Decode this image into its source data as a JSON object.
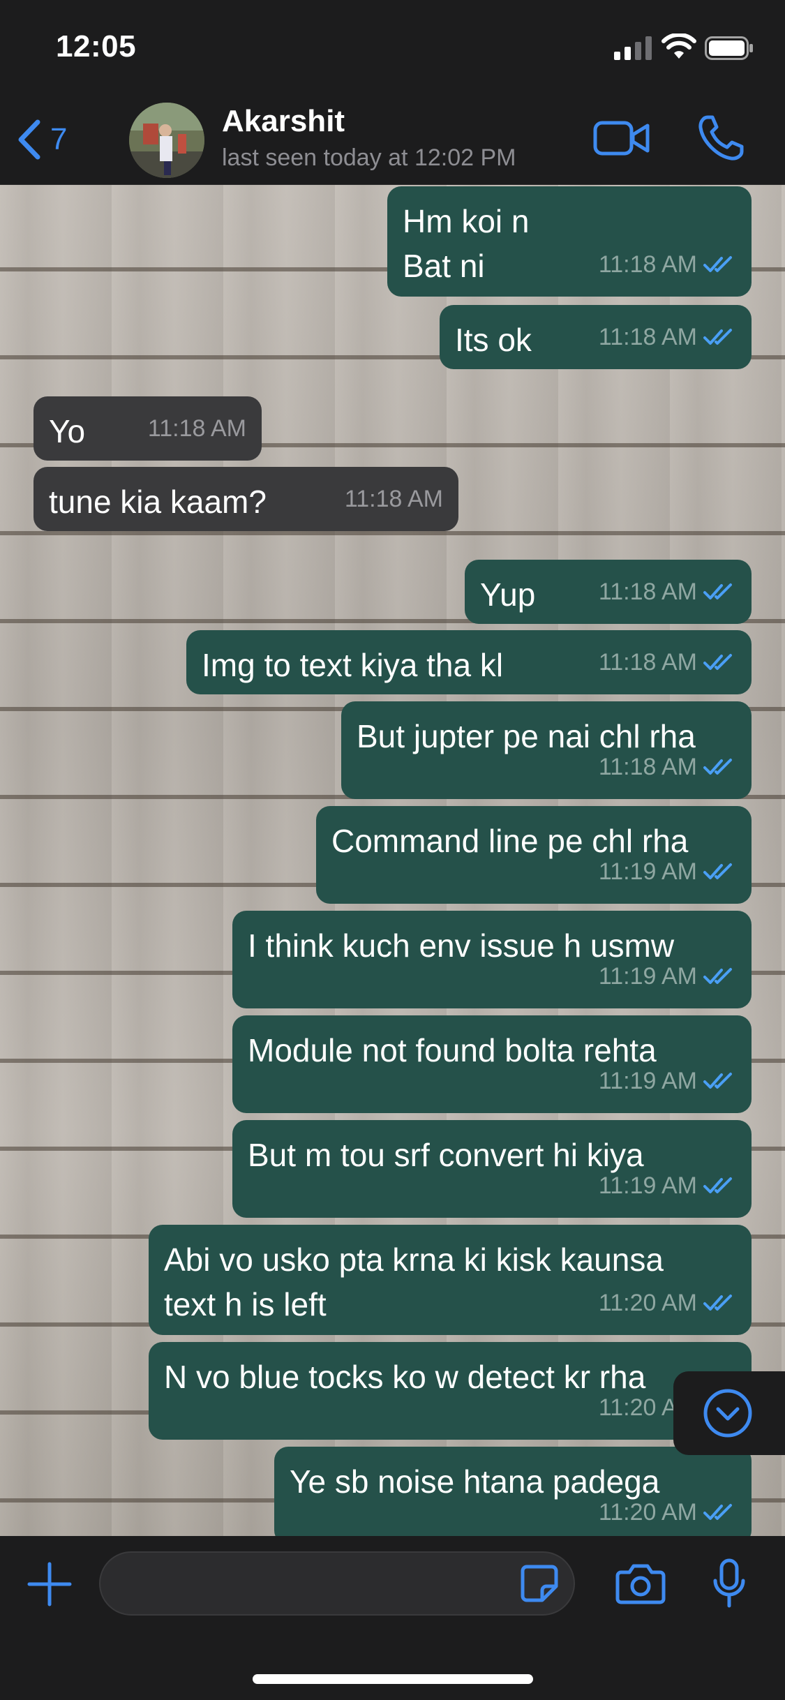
{
  "status_bar": {
    "time": "12:05"
  },
  "header": {
    "back_count": "7",
    "contact_name": "Akarshit",
    "contact_status": "last seen today at 12:02 PM"
  },
  "messages": [
    {
      "text": "Hm koi n\nBat ni",
      "time": "11:18 AM",
      "direction": "out"
    },
    {
      "text": "Its ok",
      "time": "11:18 AM",
      "direction": "out"
    },
    {
      "text": "Yo",
      "time": "11:18 AM",
      "direction": "in"
    },
    {
      "text": "tune kia kaam?",
      "time": "11:18 AM",
      "direction": "in"
    },
    {
      "text": "Yup",
      "time": "11:18 AM",
      "direction": "out"
    },
    {
      "text": "Img to text kiya tha kl",
      "time": "11:18 AM",
      "direction": "out"
    },
    {
      "text": "But jupter pe nai chl rha",
      "time": "11:18 AM",
      "direction": "out"
    },
    {
      "text": "Command line pe chl rha",
      "time": "11:19 AM",
      "direction": "out"
    },
    {
      "text": "I think kuch env issue h usmw",
      "time": "11:19 AM",
      "direction": "out"
    },
    {
      "text": "Module not found bolta rehta",
      "time": "11:19 AM",
      "direction": "out"
    },
    {
      "text": "But m tou srf convert hi kiya",
      "time": "11:19 AM",
      "direction": "out"
    },
    {
      "text": "Abi vo usko pta krna ki kisk kaunsa\ntext h is left",
      "time": "11:20 AM",
      "direction": "out"
    },
    {
      "text": "N vo blue tocks ko w detect kr rha",
      "time": "11:20 AM",
      "direction": "out"
    },
    {
      "text": "Ye sb noise htana padega",
      "time": "11:20 AM",
      "direction": "out"
    }
  ],
  "colors": {
    "accent": "#3e8af0",
    "outgoing_bubble": "#25514a",
    "incoming_bubble": "#3a3a3c",
    "read_ticks": "#4a9ff5"
  },
  "icons": [
    "back-chevron-icon",
    "video-call-icon",
    "phone-call-icon",
    "scroll-down-icon",
    "plus-icon",
    "sticker-icon",
    "camera-icon",
    "microphone-icon",
    "double-check-icon"
  ]
}
